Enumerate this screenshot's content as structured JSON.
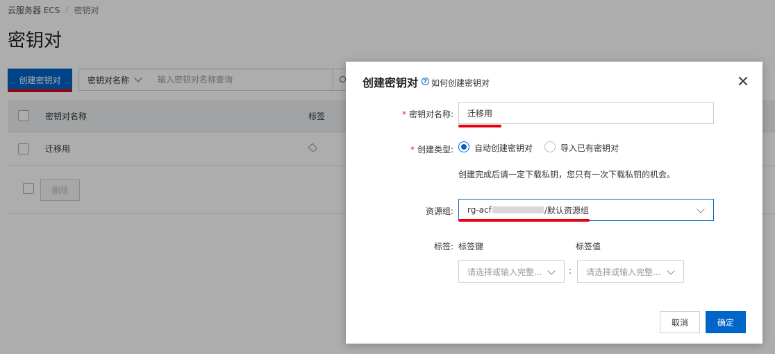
{
  "breadcrumb": {
    "root": "云服务器 ECS",
    "separator": "/",
    "current": "密钥对"
  },
  "page": {
    "title": "密钥对",
    "create_button": "创建密钥对"
  },
  "filter": {
    "field_label": "密钥对名称",
    "placeholder": "输入密钥对名称查询"
  },
  "table": {
    "columns": [
      "密钥对名称",
      "标签"
    ],
    "rows": [
      {
        "name": "迁移用"
      }
    ]
  },
  "footer": {
    "delete_button": "删除"
  },
  "dialog": {
    "title": "创建密钥对",
    "help_link": "如何创建密钥对",
    "name_label": "密钥对名称:",
    "name_value": "迁移用",
    "type_label": "创建类型:",
    "type_options": [
      "自动创建密钥对",
      "导入已有密钥对"
    ],
    "type_selected": "自动创建密钥对",
    "hint": "创建完成后请一定下载私钥，您只有一次下载私钥的机会。",
    "resource_group_label": "资源组:",
    "resource_group_prefix": "rg-acf",
    "resource_group_suffix": "/默认资源组",
    "tag_label": "标签:",
    "tag_key_label": "标签键",
    "tag_value_label": "标签值",
    "tag_key_placeholder": "请选择或输入完整...",
    "tag_value_placeholder": "请选择或输入完整...",
    "tag_separator": ":",
    "cancel_button": "取消",
    "confirm_button": "确定"
  },
  "colors": {
    "primary": "#0064c8",
    "annotation_red": "#e60012",
    "required": "#d93026"
  },
  "icons": [
    "search-icon",
    "chevron-down-icon",
    "tag-icon",
    "help-icon",
    "close-icon"
  ]
}
